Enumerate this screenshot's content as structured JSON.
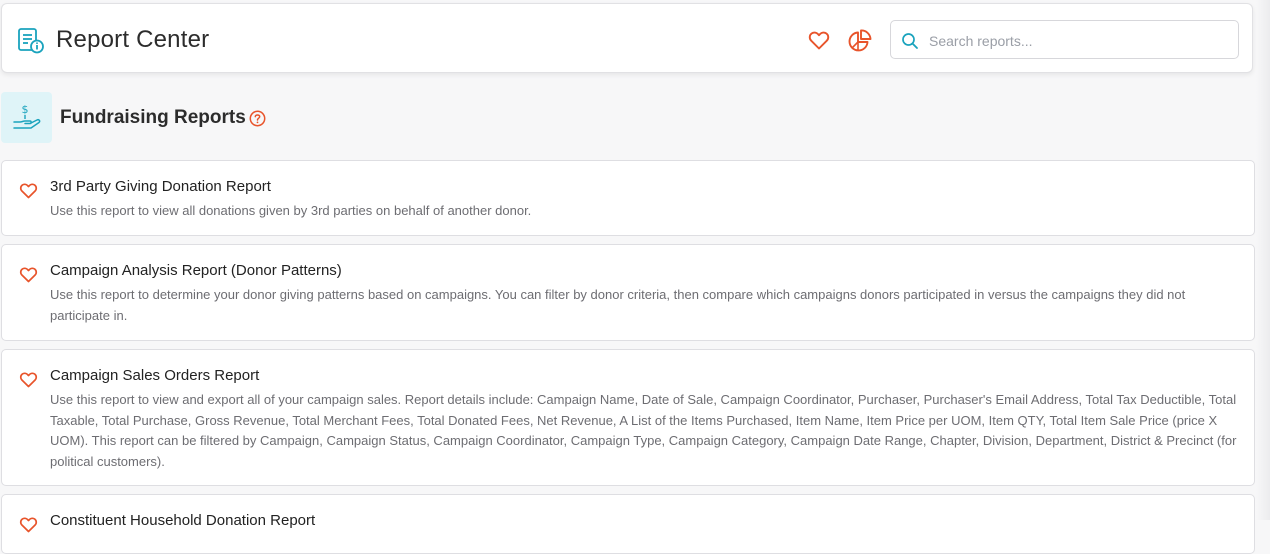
{
  "header": {
    "title": "Report Center",
    "title_icon": "report-list-icon",
    "favorites_icon": "heart-icon",
    "chart_icon": "pie-chart-icon",
    "search": {
      "placeholder": "Search reports...",
      "value": ""
    }
  },
  "section": {
    "title": "Fundraising Reports",
    "icon": "hand-dollar-icon",
    "help_icon": "help-circle-icon"
  },
  "reports": [
    {
      "title": "3rd Party Giving Donation Report",
      "description": "Use this report to view all donations given by 3rd parties on behalf of another donor."
    },
    {
      "title": "Campaign Analysis Report (Donor Patterns)",
      "description": "Use this report to determine your donor giving patterns based on campaigns. You can filter by donor criteria, then compare which campaigns donors participated in versus the campaigns they did not participate in."
    },
    {
      "title": "Campaign Sales Orders Report",
      "description": "Use this report to view and export all of your campaign sales. Report details include: Campaign Name, Date of Sale, Campaign Coordinator, Purchaser, Purchaser's Email Address, Total Tax Deductible, Total Taxable, Total Purchase, Gross Revenue, Total Merchant Fees, Total Donated Fees, Net Revenue, A List of the Items Purchased, Item Name, Item Price per UOM, Item QTY, Total Item Sale Price (price X UOM). This report can be filtered by Campaign, Campaign Status, Campaign Coordinator, Campaign Type, Campaign Category, Campaign Date Range, Chapter, Division, Department, District & Precinct (for political customers)."
    },
    {
      "title": "Constituent Household Donation Report",
      "description": ""
    }
  ],
  "colors": {
    "accent_orange": "#e8542b",
    "accent_teal": "#1aa3bd",
    "section_icon_bg": "#dff4f8"
  }
}
